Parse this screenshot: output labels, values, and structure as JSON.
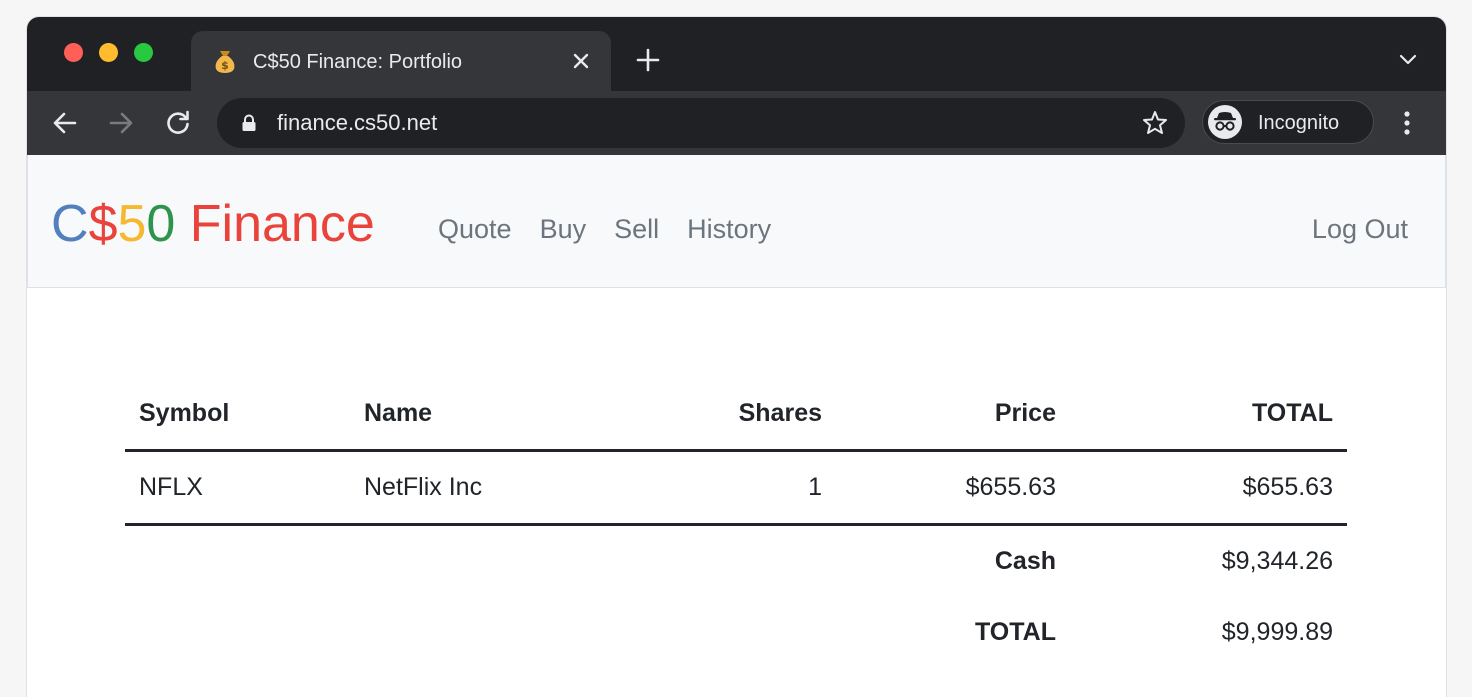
{
  "browser": {
    "tab_title": "C$50 Finance: Portfolio",
    "tab_favicon": "money-bag-icon",
    "url": "finance.cs50.net",
    "profile_label": "Incognito"
  },
  "navbar": {
    "brand": {
      "part1": "C",
      "part2": "$",
      "part3": "5",
      "part4": "0",
      "part5": " Finance"
    },
    "links": [
      "Quote",
      "Buy",
      "Sell",
      "History"
    ],
    "logout_label": "Log Out"
  },
  "portfolio": {
    "headers": {
      "symbol": "Symbol",
      "name": "Name",
      "shares": "Shares",
      "price": "Price",
      "total": "TOTAL"
    },
    "rows": [
      {
        "symbol": "NFLX",
        "name": "NetFlix Inc",
        "shares": "1",
        "price": "$655.63",
        "total": "$655.63"
      }
    ],
    "cash_label": "Cash",
    "cash_value": "$9,344.26",
    "grand_total_label": "TOTAL",
    "grand_total_value": "$9,999.89"
  },
  "colors": {
    "brand_blue": "#537fbe",
    "brand_red": "#ea433b",
    "brand_yellow": "#f5b82e",
    "brand_green": "#2e944b",
    "chrome_dark": "#202124",
    "chrome_tab": "#35363a"
  }
}
